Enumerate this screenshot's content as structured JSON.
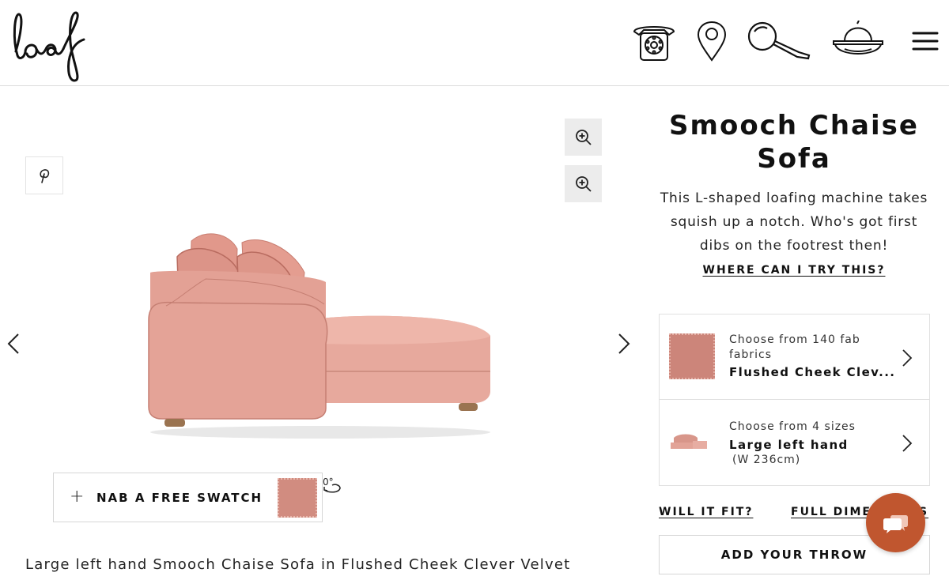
{
  "header": {
    "logo_text": "loaf",
    "icons": [
      "phone-icon",
      "store-locator-icon",
      "search-icon",
      "basket-icon",
      "menu-icon"
    ]
  },
  "gallery": {
    "swatch_button_label": "NAB A FREE SWATCH",
    "rotation_label": "0°",
    "caption": "Large left hand Smooch Chaise Sofa in Flushed Cheek Clever Velvet",
    "colors": {
      "sofa": "#e7a79b",
      "swatch": "#d18c80"
    }
  },
  "product": {
    "title": "Smooch Chaise Sofa",
    "description": "This L-shaped loafing machine takes squish up a notch. Who's got first dibs on the footrest then!",
    "where_link": "WHERE CAN I TRY THIS?",
    "fabric_option": {
      "line1": "Choose from 140 fab",
      "line1b": "fabrics",
      "selected": "Flushed Cheek Clev..."
    },
    "size_option": {
      "line1": "Choose from 4 sizes",
      "selected": "Large left hand",
      "dimension": "(W 236cm)"
    },
    "will_it_fit_link": "WILL IT FIT?",
    "full_dims_link": "FULL DIME",
    "full_dims_tail": "S",
    "throw_button": "ADD YOUR THROW"
  },
  "chat": {
    "accent": "#c0562f"
  }
}
